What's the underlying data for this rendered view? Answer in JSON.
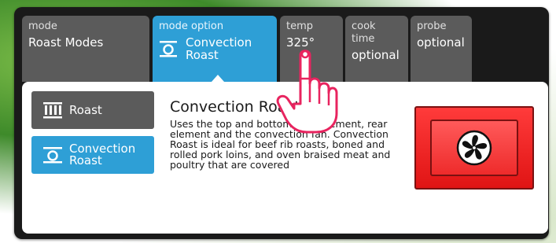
{
  "tabs": [
    {
      "label": "mode",
      "value": "Roast Modes"
    },
    {
      "label": "mode option",
      "value": "Convection Roast",
      "value_lines": [
        "Convection",
        "Roast"
      ],
      "icon": "convection-icon"
    },
    {
      "label": "temp",
      "value": "325°"
    },
    {
      "label": "cook time",
      "value": "optional"
    },
    {
      "label": "probe",
      "value": "optional"
    }
  ],
  "modes": [
    {
      "label": "Roast",
      "icon": "roast-heat-bars-icon"
    },
    {
      "label": "Convection Roast",
      "label_lines": [
        "Convection",
        "Roast"
      ],
      "icon": "convection-icon"
    }
  ],
  "description": {
    "title": "Convection Roast",
    "body": "Uses the top and bottom heat element, rear element and the convection fan. Convection Roast is ideal for beef rib roasts, boned and rolled pork loins, and oven braised meat and poultry that are covered"
  },
  "start_button": {
    "icon": "fan-icon"
  },
  "overlay": {
    "icon": "pointing-hand-cursor-icon"
  },
  "colors": {
    "active_blue": "#2e9fd6",
    "inactive_gray": "#5b5b5b",
    "start_red": "#ef2323",
    "frame_dark": "#1a1a1a",
    "hand_pink": "#e8245f"
  }
}
